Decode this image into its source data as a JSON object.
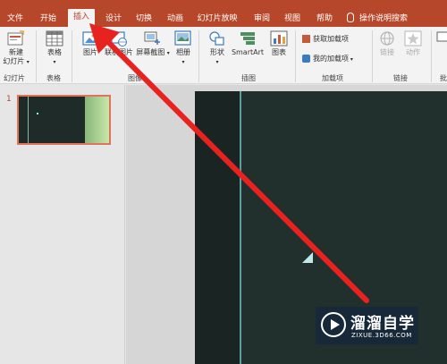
{
  "tabs": {
    "file": "文件",
    "home": "开始",
    "insert": "插入",
    "design": "设计",
    "transitions": "切换",
    "animations": "动画",
    "slideshow": "幻灯片放映",
    "review": "审阅",
    "view": "视图",
    "help": "帮助",
    "tell_me": "操作说明搜索"
  },
  "ribbon": {
    "new_slide": "新建\n幻灯片",
    "new_slide_line1": "新建",
    "new_slide_line2": "幻灯片",
    "table": "表格",
    "pictures": "图片",
    "online_pictures": "联机图片",
    "screenshot": "屏幕截图",
    "album": "相册",
    "shapes": "形状",
    "smartart": "SmartArt",
    "chart": "图表",
    "get_addins": "获取加载项",
    "my_addins": "我的加载项",
    "link": "链接",
    "action": "动作",
    "group_slides": "幻灯片",
    "group_tables": "表格",
    "group_images": "图像",
    "group_illustrations": "插图",
    "group_addins": "加载项",
    "group_links": "链接",
    "group_more": "批"
  },
  "slides_panel": {
    "slide_number": "1"
  },
  "watermark": {
    "title": "溜溜自学",
    "url": "ZIXUE.3D66.COM"
  },
  "colors": {
    "accent": "#b7472a",
    "arrow": "#e8231f"
  }
}
